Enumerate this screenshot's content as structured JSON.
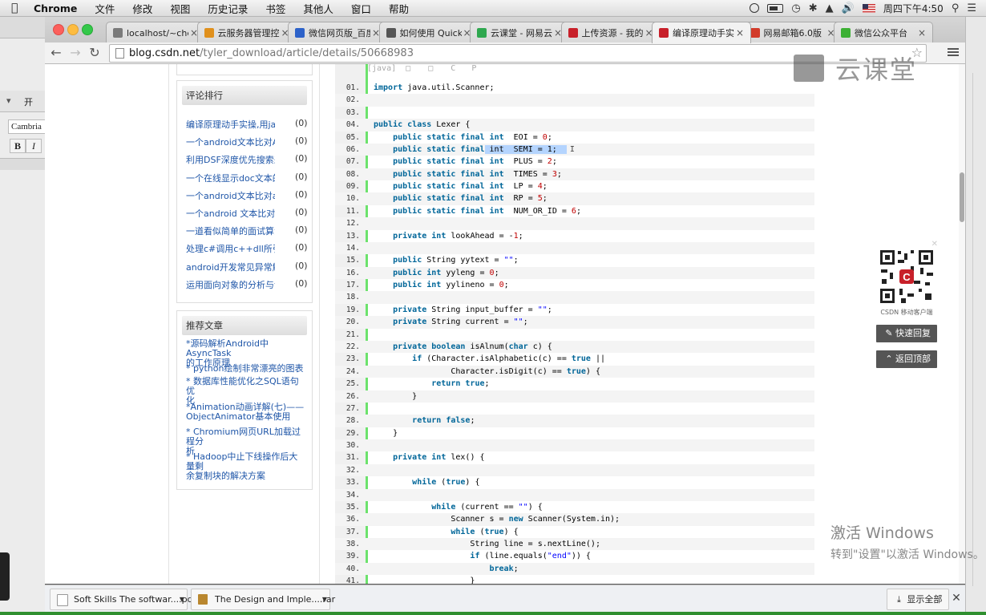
{
  "menubar": {
    "app": "Chrome",
    "items": [
      "文件",
      "修改",
      "视图",
      "历史记录",
      "书签",
      "其他人",
      "窗口",
      "帮助"
    ],
    "clock": "周四下午4:50"
  },
  "tabs": [
    {
      "label": "localhost/~che",
      "color": "#7a7a7a",
      "icon": "page-icon"
    },
    {
      "label": "云服务器管理控",
      "color": "#e0901c",
      "icon": "cloud-icon"
    },
    {
      "label": "微信网页版_百度",
      "color": "#2d62c9",
      "icon": "paw-icon"
    },
    {
      "label": "如何使用 Quick",
      "color": "#555555",
      "icon": "github-icon"
    },
    {
      "label": "云课堂 - 网易云",
      "color": "#2fa84f",
      "icon": "cloud-class-icon"
    },
    {
      "label": "上传资源 - 我的",
      "color": "#c8202a",
      "icon": "csdn-icon"
    },
    {
      "label": "编译原理动手实现",
      "color": "#c8202a",
      "icon": "csdn-icon"
    },
    {
      "label": "网易邮箱6.0版",
      "color": "#d23b2a",
      "icon": "mail-icon"
    },
    {
      "label": "微信公众平台",
      "color": "#3cb034",
      "icon": "wechat-icon"
    }
  ],
  "address": {
    "host": "blog.csdn.net",
    "path": "/tyler_download/article/details/50668983"
  },
  "comments": {
    "title": "评论排行",
    "items": [
      {
        "text": "编译原理动手实操,用java",
        "count": "(0)"
      },
      {
        "text": "一个android文本比对API",
        "count": "(0)"
      },
      {
        "text": "利用DSF深度优先搜索来",
        "count": "(0)"
      },
      {
        "text": "一个在线显示doc文本的",
        "count": "(0)"
      },
      {
        "text": "一个android文本比对app",
        "count": "(0)"
      },
      {
        "text": "一个android 文本比对Ap",
        "count": "(0)"
      },
      {
        "text": "一道看似简单的面试算法",
        "count": "(0)"
      },
      {
        "text": "处理c#调用c++dll所引起",
        "count": "(0)"
      },
      {
        "text": "android开发常见异常解析",
        "count": "(0)"
      },
      {
        "text": "运用面向对象的分析与设",
        "count": "(0)"
      }
    ]
  },
  "recommended": {
    "title": "推荐文章",
    "items": [
      [
        "*源码解析Android中AsyncTask",
        "的工作原理"
      ],
      [
        "* python绘制非常漂亮的图表"
      ],
      [
        "* 数据库性能优化之SQL语句优",
        "化"
      ],
      [
        "*Animation动画详解(七)——",
        "ObjectAnimator基本使用"
      ],
      [
        "* Chromium网页URL加载过程分",
        "析"
      ],
      [
        "* Hadoop中止下线操作后大量剩",
        "余复制块的解决方案"
      ]
    ]
  },
  "code": {
    "toolbar": "[java]",
    "lines": [
      "import java.util.Scanner;",
      "",
      "",
      "public class Lexer {",
      "    public static final int  EOI = 0;",
      "    public static final int  SEMI = 1;",
      "    public static final int  PLUS = 2;",
      "    public static final int  TIMES = 3;",
      "    public static final int  LP = 4;",
      "    public static final int  RP = 5;",
      "    public static final int  NUM_OR_ID = 6;",
      "",
      "    private int lookAhead = -1;",
      "",
      "    public String yytext = \"\";",
      "    public int yyleng = 0;",
      "    public int yylineno = 0;",
      "",
      "    private String input_buffer = \"\";",
      "    private String current = \"\";",
      "",
      "    private boolean isAlnum(char c) {",
      "        if (Character.isAlphabetic(c) == true ||",
      "                Character.isDigit(c) == true) {",
      "            return true;",
      "        }",
      "",
      "        return false;",
      "    }",
      "",
      "    private int lex() {",
      "",
      "        while (true) {",
      "",
      "            while (current == \"\") {",
      "                Scanner s = new Scanner(System.in);",
      "                while (true) {",
      "                    String line = s.nextLine();",
      "                    if (line.equals(\"end\")) {",
      "                        break;",
      "                    }"
    ]
  },
  "qr": {
    "caption": "CSDN 移动客户端"
  },
  "side_buttons": {
    "reply": "快速回复",
    "top": "返回顶部"
  },
  "watermark": {
    "text": "云课堂"
  },
  "activate": {
    "line1": "激活 Windows",
    "line2": "转到\"设置\"以激活 Windows。"
  },
  "left_app": {
    "font": "Cambria",
    "bold": "B",
    "italic": "I",
    "tab": "开"
  },
  "downloads": {
    "items": [
      "Soft Skills The softwar....pdf",
      "The Design and Imple....rar"
    ],
    "show_all": "显示全部"
  }
}
